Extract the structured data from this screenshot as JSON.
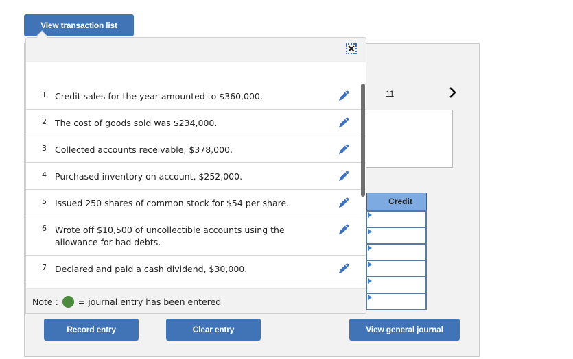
{
  "header": {
    "view_transaction_list_label": "View transaction list"
  },
  "overlay": {
    "close_icon": "close-icon",
    "transactions": [
      {
        "num": "1",
        "text": "Credit sales for the year amounted to $360,000."
      },
      {
        "num": "2",
        "text": "The cost of goods sold was $234,000."
      },
      {
        "num": "3",
        "text": "Collected accounts receivable, $378,000."
      },
      {
        "num": "4",
        "text": "Purchased inventory on account, $252,000."
      },
      {
        "num": "5",
        "text": "Issued 250 shares of common stock for $54 per share."
      },
      {
        "num": "6",
        "text": "Wrote off $10,500 of uncollectible accounts using the allowance for bad debts."
      },
      {
        "num": "7",
        "text": "Declared and paid a cash dividend, $30,000."
      }
    ],
    "note": {
      "prefix": "Note :",
      "suffix": "= journal entry has been entered",
      "dot_color": "#4b8b3b"
    }
  },
  "journal": {
    "page_number": "11",
    "credit_header": "Credit",
    "rows": 6
  },
  "buttons": {
    "record_entry": "Record entry",
    "clear_entry": "Clear entry",
    "view_general_journal": "View general journal"
  },
  "colors": {
    "button": "#4074b6",
    "table_header": "#7eaae2",
    "edit_icon": "#3d72c0"
  }
}
